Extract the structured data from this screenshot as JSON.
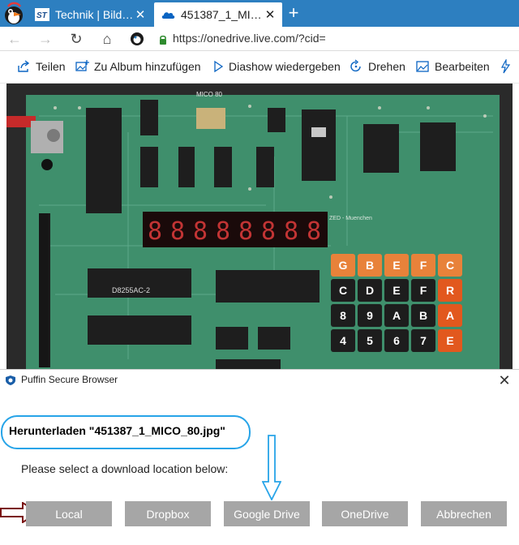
{
  "browser": {
    "tabs": [
      {
        "title": "Technik | Bild…",
        "favicon": "st-favicon-icon",
        "active": false
      },
      {
        "title": "451387_1_MI…",
        "favicon": "onedrive-cloud-icon",
        "active": true
      }
    ],
    "newtab_glyph": "+",
    "close_glyph": "✕",
    "nav": {
      "back": "←",
      "forward": "→",
      "reload": "↻",
      "home": "⌂"
    },
    "url": "https://onedrive.live.com/?cid=",
    "accent": "#2d7fc0"
  },
  "commandbar": {
    "items": [
      {
        "label": "Teilen",
        "icon": "share-icon"
      },
      {
        "label": "Zu Album hinzufügen",
        "icon": "add-to-album-icon"
      },
      {
        "label": "Diashow wiedergeben",
        "icon": "play-icon"
      },
      {
        "label": "Drehen",
        "icon": "rotate-icon"
      },
      {
        "label": "Bearbeiten",
        "icon": "edit-image-icon"
      }
    ],
    "overflow_icon": "lightning-icon"
  },
  "photo": {
    "board_label_top": "MICO 80",
    "board_label_mid": "ZED - Muenchen",
    "chip_label": "D8255AC-2",
    "display_digits": [
      "8",
      "8",
      "8",
      "8",
      "8",
      "8",
      "8",
      "8"
    ],
    "keypad_rows": [
      [
        "G",
        "B",
        "E",
        "F",
        "C"
      ],
      [
        "C",
        "D",
        "E",
        "F",
        "R"
      ],
      [
        "8",
        "9",
        "A",
        "B",
        "A"
      ],
      [
        "4",
        "5",
        "6",
        "7",
        "E"
      ]
    ]
  },
  "dialog": {
    "window_title": "Puffin Secure Browser",
    "close_glyph": "✕",
    "heading": "Herunterladen \"451387_1_MICO_80.jpg\"",
    "prompt": "Please select a download location below:",
    "buttons": [
      "Local",
      "Dropbox",
      "Google Drive",
      "OneDrive",
      "Abbrechen"
    ],
    "button_color": "#a6a6a6",
    "annotation_color": "#27a4e8",
    "pointer_arrow_color": "#7a1010"
  }
}
